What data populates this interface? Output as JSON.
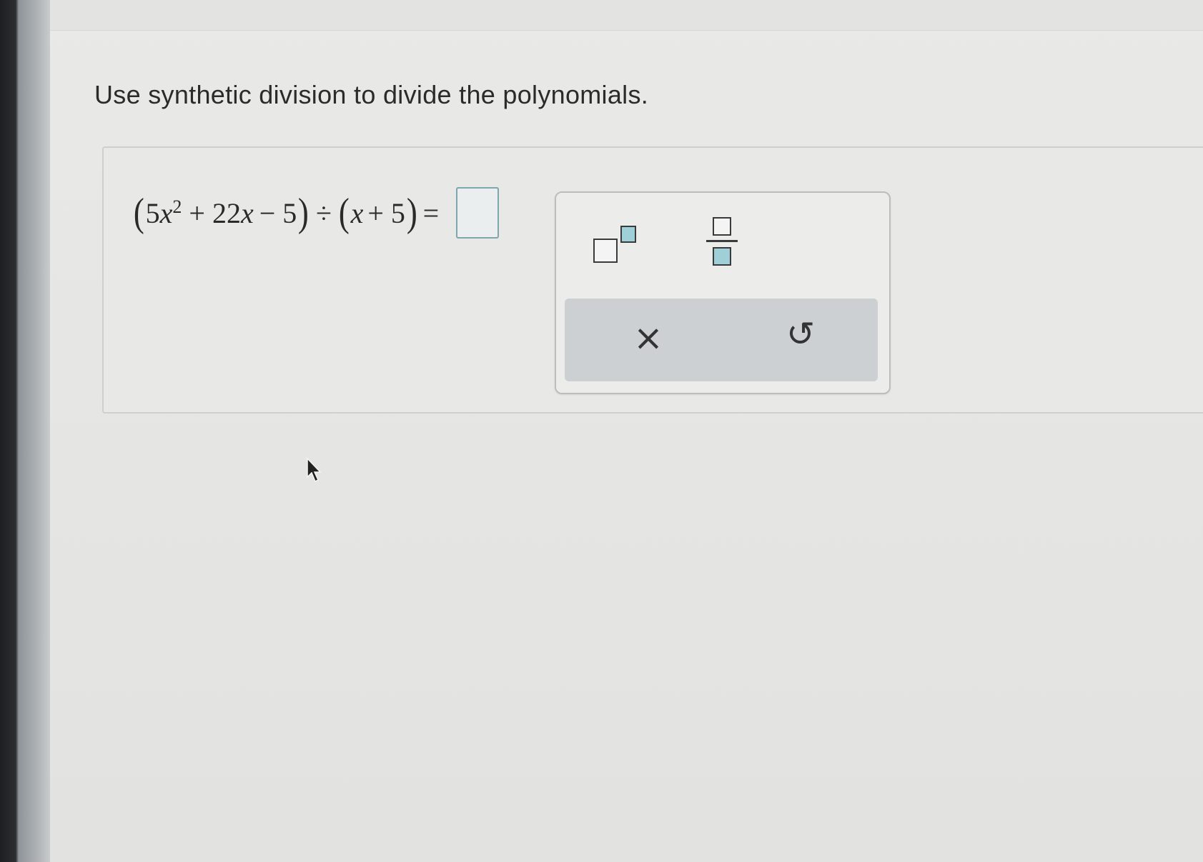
{
  "instruction": "Use synthetic division to divide the polynomials.",
  "equation": {
    "open_paren_1": "(",
    "coef_5": "5",
    "x_var": "x",
    "exponent": "2",
    "plus_22x": "+ 22",
    "x_var_2": "x",
    "minus_5": "− 5",
    "close_paren_1": ")",
    "divide": "÷",
    "open_paren_2": "(",
    "x_var_3": "x",
    "plus_5": "+ 5",
    "close_paren_2": ")",
    "equals": "="
  },
  "answer": {
    "value": ""
  },
  "palette": {
    "exponent_icon": "exponent-template-icon",
    "fraction_icon": "fraction-template-icon",
    "clear_symbol": "×",
    "undo_symbol": "↺"
  },
  "colors": {
    "answer_border": "#7fa6ae",
    "template_highlight": "#9fd0d8",
    "action_bar": "#cdd0d2"
  }
}
